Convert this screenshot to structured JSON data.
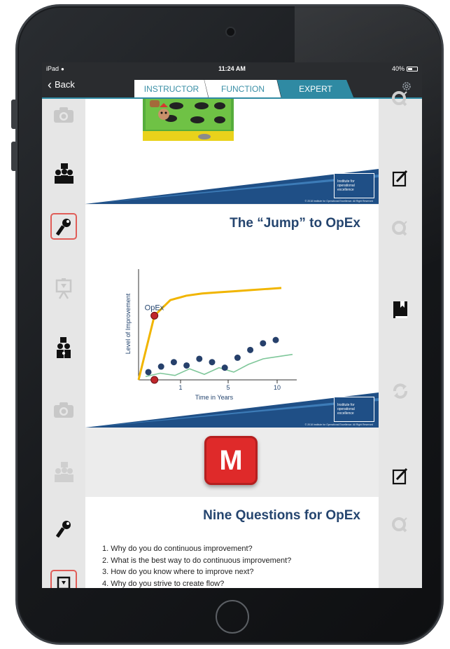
{
  "status_bar": {
    "device": "iPad",
    "time": "11:24 AM",
    "battery": "40%"
  },
  "nav": {
    "back_label": "Back"
  },
  "tabs": [
    {
      "label": "INSTRUCTOR",
      "active": false
    },
    {
      "label": "FUNCTION",
      "active": false
    },
    {
      "label": "EXPERT",
      "active": true
    }
  ],
  "left_rail": [
    "camera-icon",
    "team-icon",
    "key-icon",
    "presentation-icon",
    "people-flow-icon",
    "camera-icon",
    "team-icon",
    "key-icon",
    "presentation-icon"
  ],
  "right_rail": [
    "search-icon",
    "edit-icon",
    "search-icon",
    "book-icon",
    "refresh-icon",
    "edit-icon",
    "search-icon"
  ],
  "slide_jump": {
    "title": "The “Jump” to OpEx",
    "chart_data": {
      "type": "line",
      "ylabel": "Level of Improvement",
      "xlabel": "Time in Years",
      "x_ticks": [
        "1",
        "5",
        "10"
      ],
      "annotation": "OpEx",
      "series": [
        {
          "values": [
            0,
            58,
            72,
            76,
            78,
            79,
            80,
            81,
            82,
            83
          ]
        },
        {
          "values": [
            7,
            12,
            16,
            13,
            19,
            16,
            11,
            20,
            27,
            33,
            36
          ]
        },
        {
          "values": [
            3,
            6,
            4,
            10,
            5,
            11,
            7,
            14,
            19,
            21,
            23
          ]
        }
      ]
    },
    "logo_text": "Institute for operational excellence",
    "copyright": "© 2018 Institute for Operational Excellence. All Right Reserved"
  },
  "slide_top": {
    "logo_text": "Institute for operational excellence",
    "copyright": "© 2018 Institute for Operational Excellence. All Right Reserved"
  },
  "m_badge": {
    "label": "M"
  },
  "slide_questions": {
    "title": "Nine Questions for OpEx",
    "items": [
      "1. Why do you do continuous improvement?",
      "2. What is the best way to do continuous improvement?",
      "3. How do you know where to improve next?",
      "4. Why do you strive to create flow?"
    ]
  },
  "colors": {
    "accent": "#2f8aa3",
    "navy": "#25456f",
    "brand_red": "#df2a2a",
    "chart_gold": "#f1b500",
    "chart_green": "#7fc79a"
  }
}
